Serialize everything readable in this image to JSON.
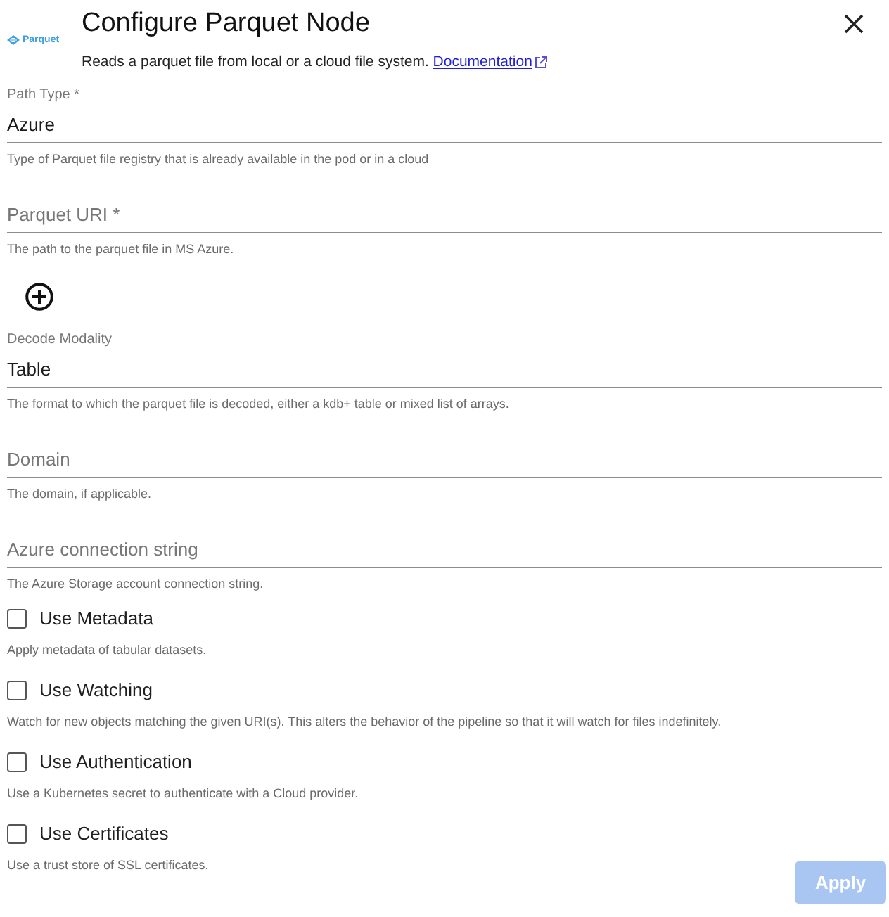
{
  "header": {
    "logo": {
      "text": "Parquet"
    },
    "title": "Configure Parquet Node",
    "description": "Reads a parquet file from local or a cloud file system.",
    "link": {
      "text": "Documentation",
      "external": true
    }
  },
  "items": [
    {
      "kind": "field",
      "label": "Path Type *",
      "value": "Azure",
      "hint": "Type of Parquet file registry that is already available in the pod or in a cloud"
    },
    {
      "kind": "field",
      "placeholder": "Parquet URI *",
      "hint": "The path to the parquet file in MS Azure."
    },
    {
      "kind": "add"
    },
    {
      "kind": "field",
      "label": "Decode Modality",
      "value": "Table",
      "hint": "The format to which the parquet file is decoded, either a kdb+ table or mixed list of arrays."
    },
    {
      "kind": "field",
      "placeholder": "Domain",
      "hint": "The domain, if applicable."
    },
    {
      "kind": "field",
      "placeholder": "Azure connection string",
      "hint": "The Azure Storage account connection string."
    },
    {
      "kind": "checkbox",
      "label": "Use Metadata",
      "checked": false,
      "hint": "Apply metadata of tabular datasets."
    },
    {
      "kind": "checkbox",
      "label": "Use Watching",
      "checked": false,
      "hint": "Watch for new objects matching the given URI(s). This alters the behavior of the pipeline so that it will watch for files indefinitely."
    },
    {
      "kind": "checkbox",
      "label": "Use Authentication",
      "checked": false,
      "hint": "Use a Kubernetes secret to authenticate with a Cloud provider."
    },
    {
      "kind": "checkbox",
      "label": "Use Certificates",
      "checked": false,
      "hint": "Use a trust store of SSL certificates."
    }
  ],
  "apply_button": {
    "label": "Apply",
    "disabled": true
  }
}
